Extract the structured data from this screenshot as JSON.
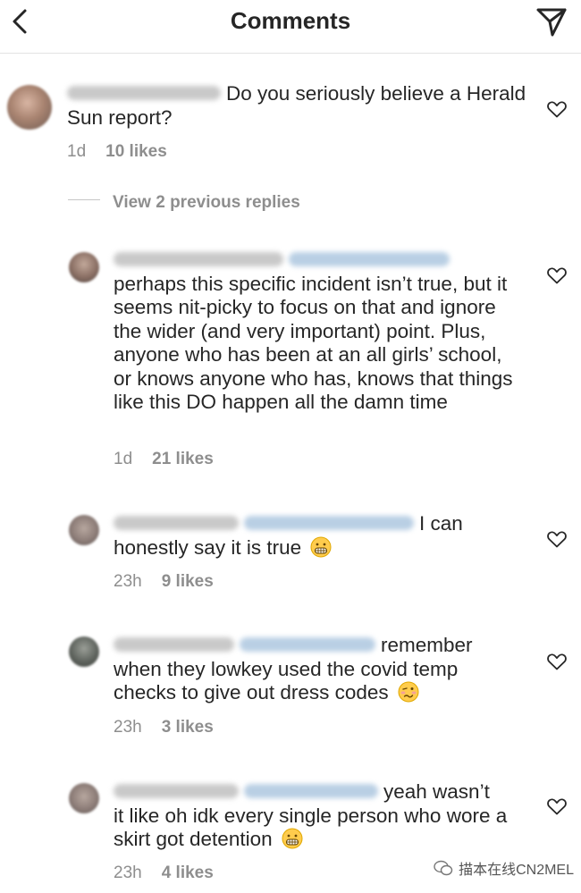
{
  "header": {
    "title": "Comments"
  },
  "main_comment": {
    "text": "Do you seriously believe a Herald Sun report?",
    "time": "1d",
    "likes": "10 likes"
  },
  "view_replies_label": "View 2 previous replies",
  "replies": [
    {
      "text_line1": "perhaps this specific incident isn’t true,",
      "text_rest": "but it seems nit-picky to focus on that and ignore the wider (and very important) point. Plus, anyone who has been at an all girls’ school, or knows anyone who has, knows that things like this DO happen all the damn time",
      "time": "1d",
      "likes": "21 likes"
    },
    {
      "text_inline": "I can",
      "text_rest": "honestly say it is true",
      "emoji": "grimacing-emoji",
      "time": "23h",
      "likes": "9 likes"
    },
    {
      "text_inline": "remember",
      "text_rest": "when they lowkey used the covid temp checks to give out dress codes",
      "emoji": "woozy-face-emoji",
      "time": "23h",
      "likes": "3 likes"
    },
    {
      "text_inline": "yeah wasn’t",
      "text_rest": "it like oh idk every single person who wore a skirt got detention",
      "emoji": "grimacing-emoji",
      "time": "23h",
      "likes": "4 likes"
    }
  ],
  "watermark": {
    "text": "描本在线CN2MEL"
  },
  "icons": {
    "back": "chevron-left-icon",
    "send": "paper-plane-icon",
    "like": "heart-outline-icon"
  },
  "colors": {
    "text": "#262626",
    "secondary": "#8e8e8e",
    "divider": "#e3e3e3"
  }
}
